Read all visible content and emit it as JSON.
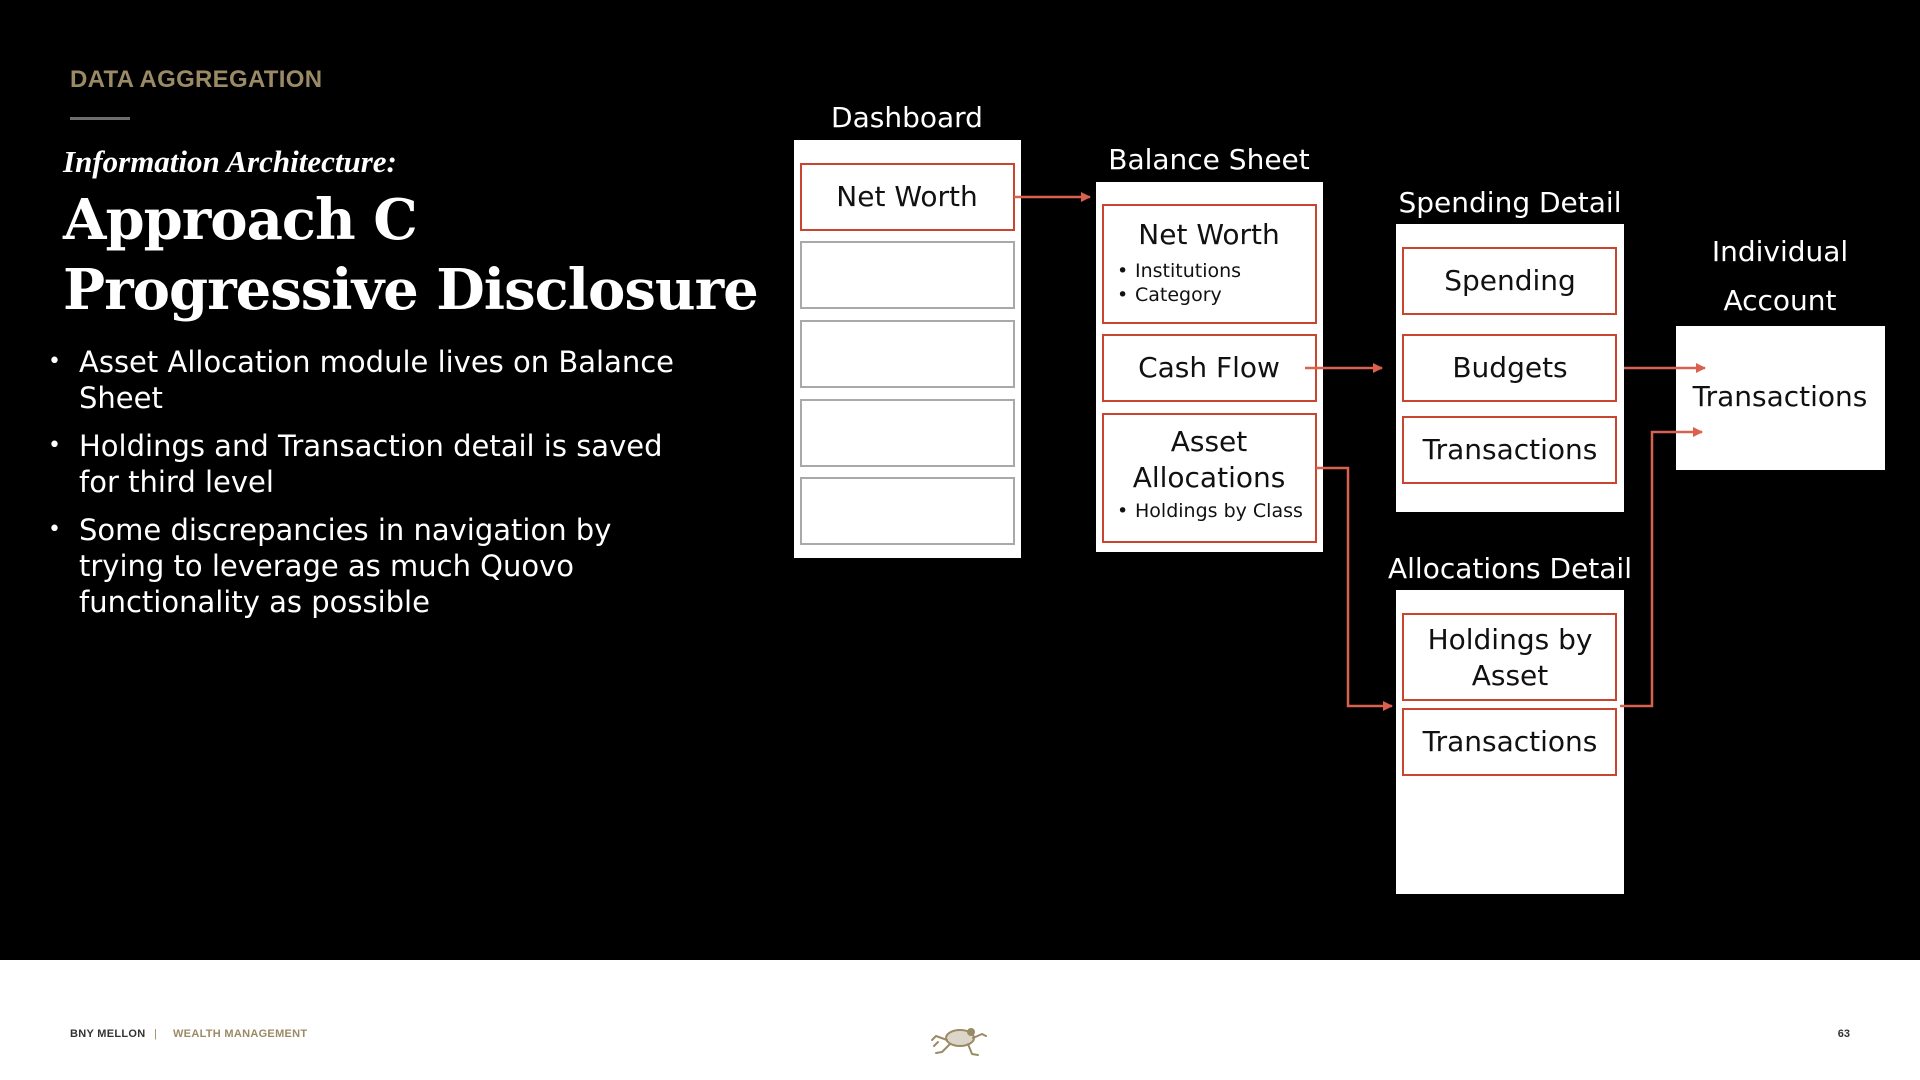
{
  "header": {
    "section_label": "DATA AGGREGATION",
    "subtitle": "Information Architecture:",
    "title_line1": "Approach C",
    "title_line2": "Progressive Disclosure"
  },
  "bullets": [
    "Asset Allocation module lives on Balance Sheet",
    "Holdings and Transaction detail is saved for third level",
    "Some discrepancies in navigation by trying to leverage as much Quovo functionality as possible"
  ],
  "diagram": {
    "dashboard": {
      "label": "Dashboard",
      "net_worth": "Net Worth"
    },
    "balance_sheet": {
      "label": "Balance Sheet",
      "net_worth": "Net Worth",
      "net_worth_sub": [
        "Institutions",
        "Category"
      ],
      "cash_flow": "Cash Flow",
      "asset_allocations_line1": "Asset",
      "asset_allocations_line2": "Allocations",
      "asset_allocations_sub": [
        "Holdings by Class"
      ]
    },
    "spending_detail": {
      "label": "Spending Detail",
      "items": [
        "Spending",
        "Budgets",
        "Transactions"
      ]
    },
    "allocations_detail": {
      "label": "Allocations Detail",
      "holdings_line1": "Holdings by",
      "holdings_line2": "Asset",
      "transactions": "Transactions"
    },
    "individual_account": {
      "label_line1": "Individual",
      "label_line2": "Account",
      "content": "Transactions"
    }
  },
  "footer": {
    "brand": "BNY MELLON",
    "separator": "|",
    "division": "WEALTH MANAGEMENT",
    "page_number": "63"
  },
  "colors": {
    "background": "#000000",
    "accent_gold": "#9b8a66",
    "arrow_red": "#d9614f",
    "box_border_red": "#c8452f",
    "empty_box_border": "#a9a9a9"
  },
  "icons": {
    "logo": "frog-logo-icon"
  }
}
